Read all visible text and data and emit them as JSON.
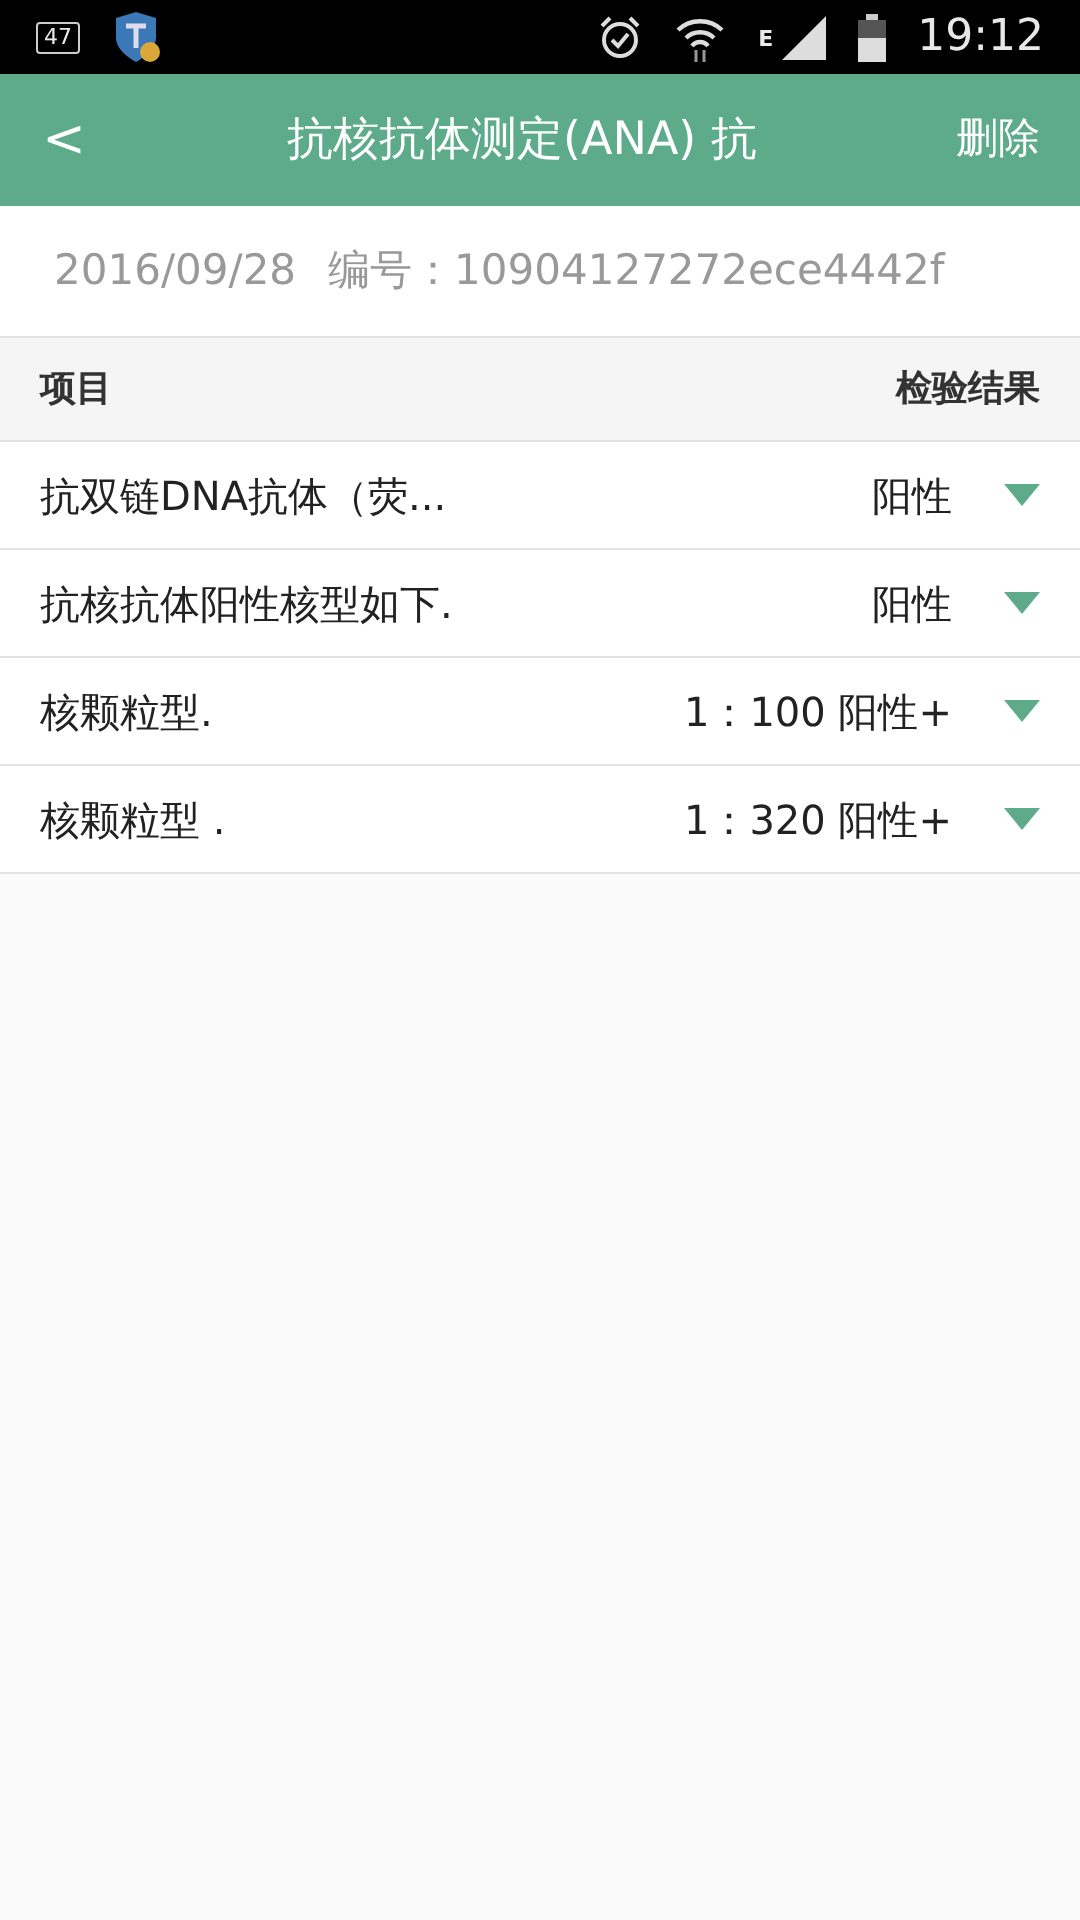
{
  "status_bar": {
    "notification_count": "47",
    "network_type": "E",
    "time": "19:12"
  },
  "app_bar": {
    "back": "<",
    "title": "抗核抗体测定(ANA) 抗",
    "action": "删除"
  },
  "report": {
    "date": "2016/09/28",
    "id_label": "编号：",
    "id": "10904127272ece4442f"
  },
  "table": {
    "columns": [
      "项目",
      "检验结果"
    ],
    "rows": [
      {
        "item": "抗双链DNA抗体（荧...",
        "result": "阳性"
      },
      {
        "item": "抗核抗体阳性核型如下.",
        "result": "阳性"
      },
      {
        "item": "核颗粒型.",
        "result": "1：100 阳性+"
      },
      {
        "item": "核颗粒型 .",
        "result": "1：320 阳性+"
      }
    ]
  }
}
